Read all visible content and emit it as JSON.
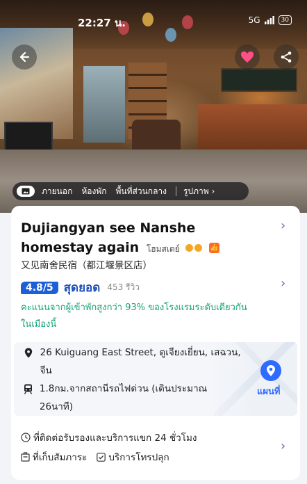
{
  "status_bar": {
    "time": "22:27 น.",
    "network": "5G",
    "battery": "30"
  },
  "photo_tabs": [
    "ภายนอก",
    "ห้องพัก",
    "พื้นที่ส่วนกลาง",
    "รูปภาพ"
  ],
  "hotel": {
    "name": "Dujiangyan see Nanshe homestay again",
    "type_label": "โฮมสเตย์",
    "local_name": "又见南舍民宿（都江堰景区店）"
  },
  "rating": {
    "score": "4.8",
    "max": "/5",
    "label": "สุดยอด",
    "reviews": "453 รีวิว",
    "description": "คะแนนจากผู้เข้าพักสูงกว่า 93% ของโรงแรมระดับเดียวกันในเมืองนี้"
  },
  "location": {
    "address": "26 Kuiguang East Street, ตูเจียงเยี่ยน, เสฉวน, จีน",
    "transit": "1.8กม.จากสถานีรถไฟด่วน (เดินประมาณ 26นาที)",
    "map_label": "แผนที่"
  },
  "amenities": {
    "front_desk": "ที่ติดต่อรับรองและบริการแขก 24 ชั่วโมง",
    "luggage": "ที่เก็บสัมภาระ",
    "wakeup": "บริการโทรปลุก"
  },
  "colors": {
    "accent": "#1c5fd6",
    "rating_text": "#18a37a",
    "favorite": "#ff4f87"
  }
}
